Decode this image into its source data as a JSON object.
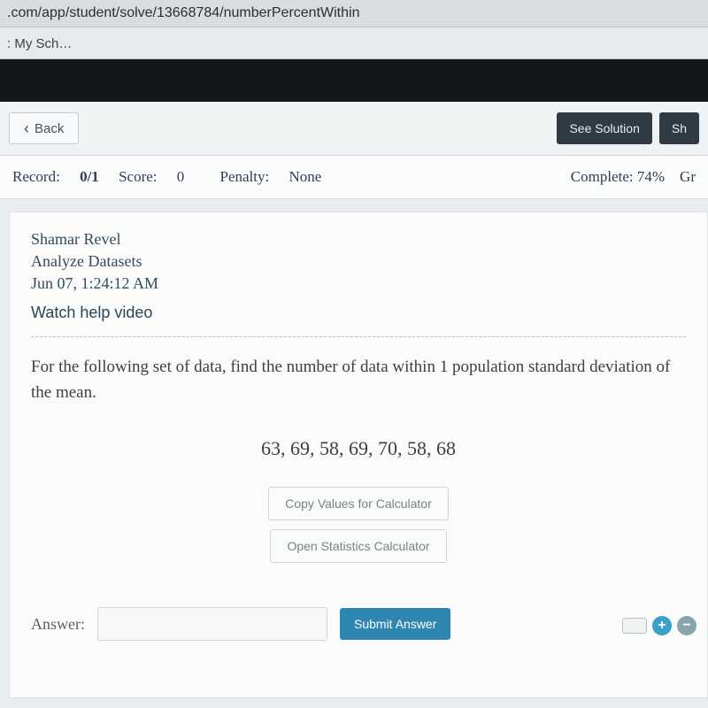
{
  "browser": {
    "url_fragment": ".com/app/student/solve/13668784/numberPercentWithin",
    "tab_title": ": My Sch…"
  },
  "nav": {
    "back_label": "Back",
    "see_solution_label": "See Solution",
    "share_label": "Sh"
  },
  "stats": {
    "record_label": "Record:",
    "record_value": "0/1",
    "score_label": "Score:",
    "score_value": "0",
    "penalty_label": "Penalty:",
    "penalty_value": "None",
    "complete_label": "Complete:",
    "complete_value": "74%",
    "grade_label": "Gr"
  },
  "problem": {
    "student_name": "Shamar Revel",
    "assignment": "Analyze Datasets",
    "timestamp": "Jun 07, 1:24:12 AM",
    "help_video": "Watch help video",
    "prompt": "For the following set of data, find the number of data within 1 population standard deviation of the mean.",
    "data_values": "63, 69, 58, 69, 70, 58, 68",
    "copy_btn": "Copy Values for Calculator",
    "open_calc_btn": "Open Statistics Calculator",
    "answer_label": "Answer:",
    "submit_label": "Submit Answer"
  }
}
